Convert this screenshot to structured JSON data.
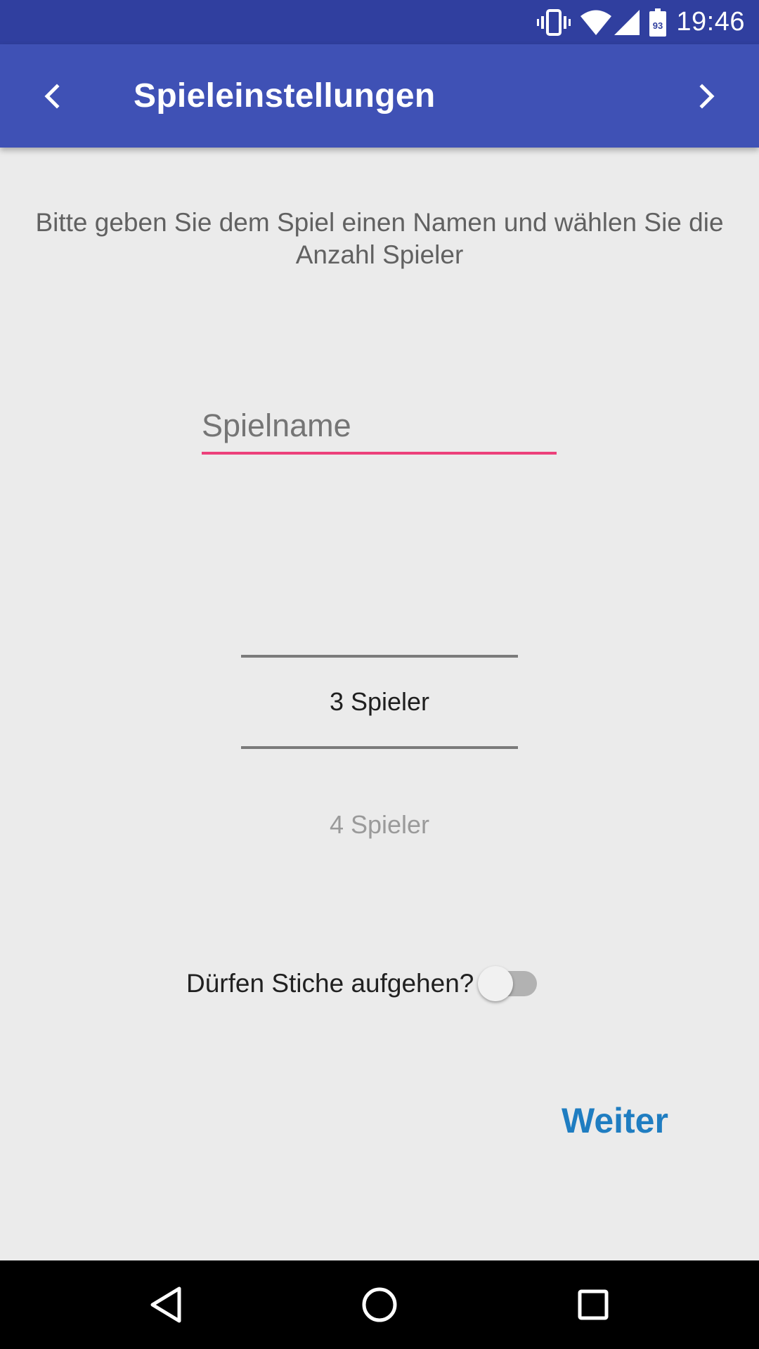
{
  "status_bar": {
    "time": "19:46",
    "battery_level": "93",
    "icons": [
      "vibrate-icon",
      "wifi-icon",
      "cell-signal-icon",
      "battery-icon"
    ]
  },
  "app_bar": {
    "title": "Spieleinstellungen",
    "back_icon": "chevron-left-icon",
    "forward_icon": "chevron-right-icon"
  },
  "form": {
    "instruction": "Bitte geben Sie dem Spiel einen Namen und wählen Sie die Anzahl Spieler",
    "game_name": {
      "value": "",
      "placeholder": "Spielname"
    },
    "player_picker": {
      "selected": "3 Spieler",
      "next": "4 Spieler"
    },
    "tricks_toggle": {
      "label": "Dürfen Stiche aufgehen?",
      "on": false
    },
    "next_button": "Weiter"
  },
  "system_nav": {
    "keys": [
      "back-triangle-icon",
      "home-circle-icon",
      "recents-square-icon"
    ]
  },
  "colors": {
    "status_bar": "#303f9f",
    "app_bar": "#3f51b5",
    "input_accent": "#ec407a",
    "button_text": "#1f7dc1",
    "background": "#ebebeb"
  }
}
